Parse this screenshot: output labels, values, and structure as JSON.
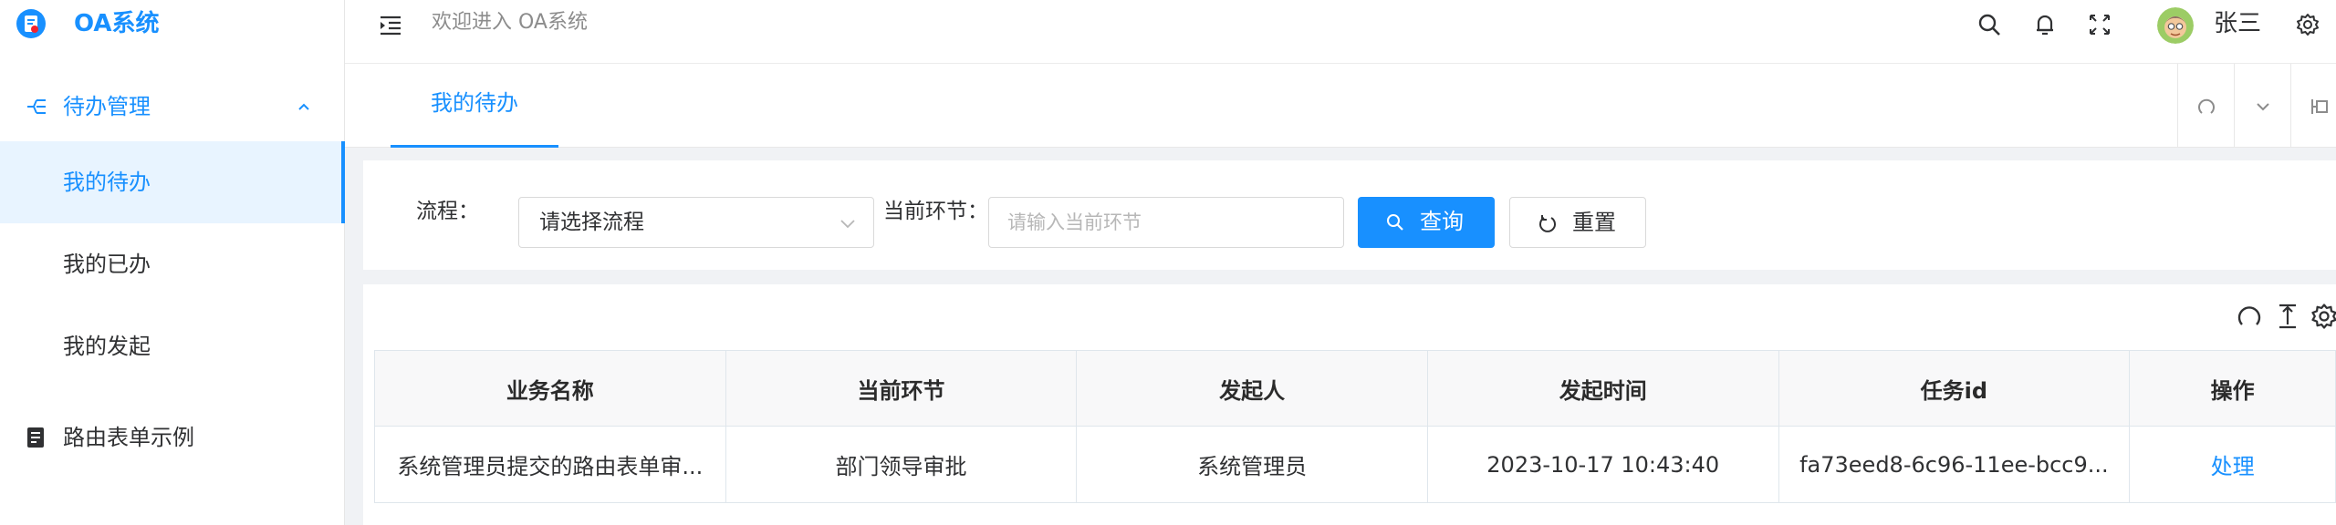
{
  "app": {
    "title": "OA系统"
  },
  "sidebar": {
    "group": {
      "label": "待办管理",
      "icon": "branch-icon",
      "expanded": true
    },
    "items": [
      {
        "label": "我的待办",
        "active": true
      },
      {
        "label": "我的已办",
        "active": false
      },
      {
        "label": "我的发起",
        "active": false
      }
    ],
    "route_item": {
      "label": "路由表单示例",
      "icon": "form-icon"
    }
  },
  "header": {
    "welcome": "欢迎进入 OA系统",
    "icons": [
      "search-icon",
      "bell-icon",
      "fullscreen-icon",
      "settings-icon"
    ],
    "user": {
      "name": "张三"
    }
  },
  "tabs": [
    {
      "label": "我的待办",
      "active": true
    }
  ],
  "tab_tools": [
    "refresh-icon",
    "chevron-down-icon",
    "maximize-icon"
  ],
  "filters": {
    "process": {
      "label": "流程：",
      "placeholder": "请选择流程"
    },
    "node": {
      "label": "当前环节：",
      "placeholder": "请输入当前环节",
      "value": ""
    },
    "query_button": "查询",
    "reset_button": "重置"
  },
  "table_tools": [
    "refresh-icon",
    "column-height-icon",
    "settings-icon"
  ],
  "table": {
    "columns": [
      "业务名称",
      "当前环节",
      "发起人",
      "发起时间",
      "任务id",
      "操作"
    ],
    "rows": [
      {
        "name": "系统管理员提交的路由表单审...",
        "node": "部门领导审批",
        "initiator": "系统管理员",
        "time": "2023-10-17 10:43:40",
        "task_id": "fa73eed8-6c96-11ee-bcc9...",
        "action": "处理"
      }
    ]
  },
  "colors": {
    "primary": "#1890ff",
    "active_bg": "#e8f4ff",
    "page_bg": "#f0f2f5"
  }
}
